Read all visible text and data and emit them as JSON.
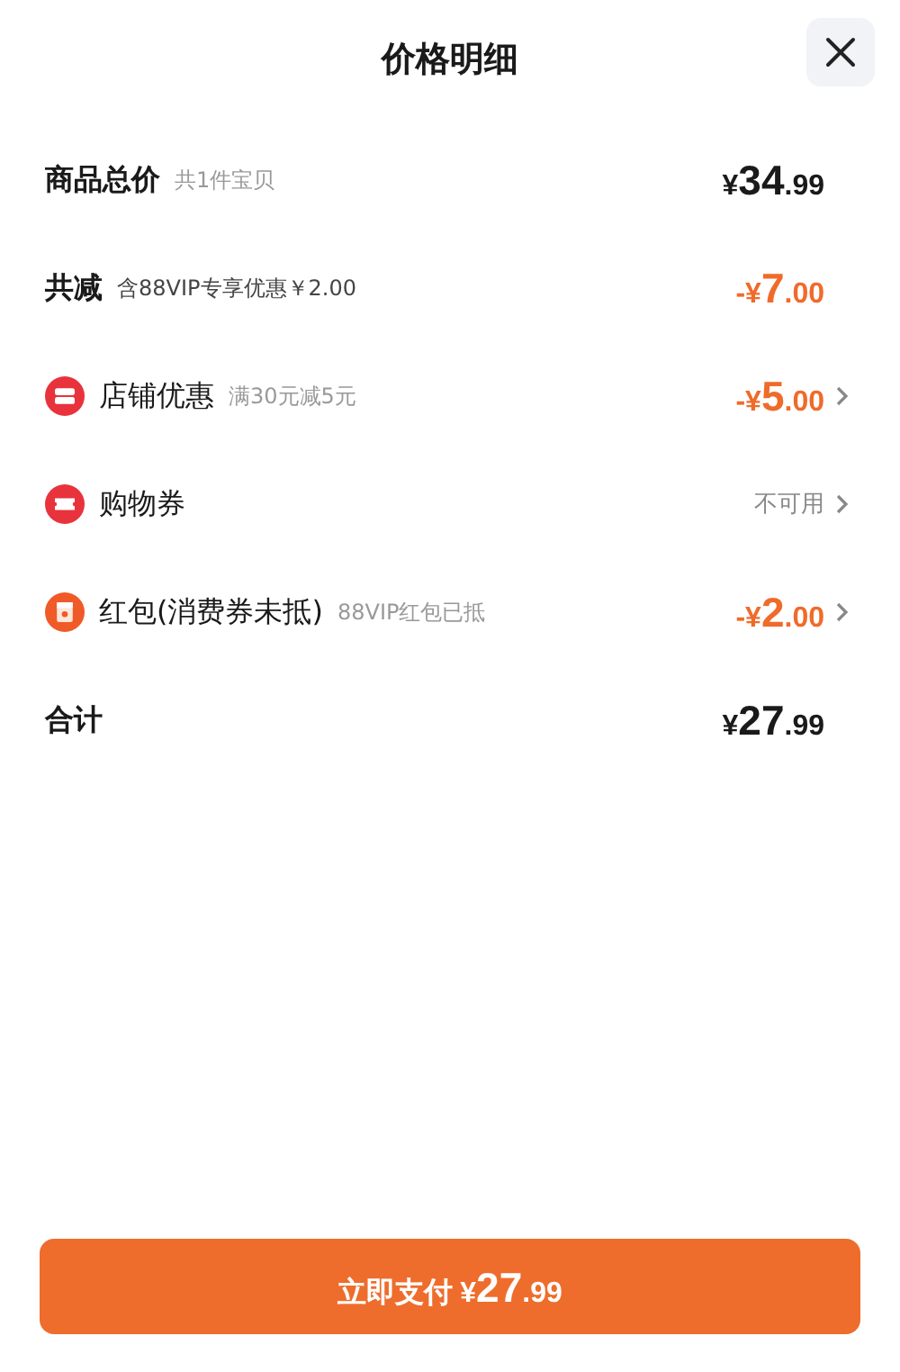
{
  "title": "价格明细",
  "rows": [
    {
      "kind": "summary",
      "label": "商品总价",
      "note": "共1件宝贝",
      "price": {
        "currency": "¥",
        "integer": "34",
        "decimals": ".99"
      },
      "chevron": false
    },
    {
      "kind": "reduction",
      "label": "共减",
      "note": "含88VIP专享优惠￥2.00",
      "price": {
        "sign": "-",
        "currency": "¥",
        "integer": "7",
        "decimals": ".00"
      },
      "chevron": false
    },
    {
      "kind": "store",
      "label": "店铺优惠",
      "note": "满30元减5元",
      "price": {
        "sign": "-",
        "currency": "¥",
        "integer": "5",
        "decimals": ".00"
      },
      "chevron": true
    },
    {
      "kind": "coupon",
      "label": "购物券",
      "status": "不可用",
      "chevron": true
    },
    {
      "kind": "red_packet",
      "label": "红包(消费券未抵)",
      "note": "88VIP红包已抵",
      "price": {
        "sign": "-",
        "currency": "¥",
        "integer": "2",
        "decimals": ".00"
      },
      "chevron": true
    },
    {
      "kind": "total",
      "label": "合计",
      "price": {
        "currency": "¥",
        "integer": "27",
        "decimals": ".99"
      },
      "chevron": false
    }
  ],
  "pay_button": {
    "label": "立即支付",
    "price": {
      "currency": "¥",
      "integer": "27",
      "decimals": ".99"
    }
  }
}
